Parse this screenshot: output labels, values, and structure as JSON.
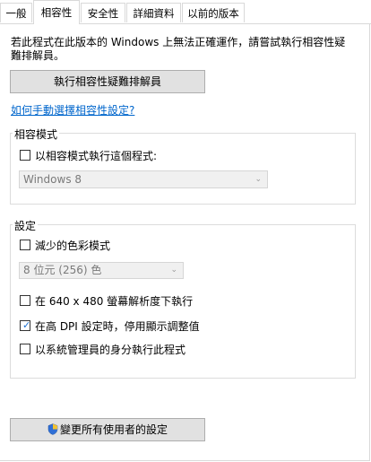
{
  "tabs": [
    {
      "label": "一般"
    },
    {
      "label": "相容性"
    },
    {
      "label": "安全性"
    },
    {
      "label": "詳細資料"
    },
    {
      "label": "以前的版本"
    }
  ],
  "intro": {
    "line1": "若此程式在此版本的 Windows 上無法正確運作，請嘗試執行相容性疑",
    "line2": "難排解員。"
  },
  "troubleshoot_button": "執行相容性疑難排解員",
  "manual_link": "如何手動選擇相容性設定?",
  "compat_mode": {
    "title": "相容模式",
    "checkbox_label": "以相容模式執行這個程式:",
    "checked": false,
    "selected_os": "Windows 8"
  },
  "settings": {
    "title": "設定",
    "reduced_color": {
      "label": "減少的色彩模式",
      "checked": false
    },
    "color_depth": "8 位元 (256) 色",
    "resolution_640": {
      "label": "在 640 x 480 螢幕解析度下執行",
      "checked": false
    },
    "high_dpi": {
      "label": "在高 DPI 設定時，停用顯示調整值",
      "checked": true
    },
    "run_as_admin": {
      "label": "以系統管理員的身分執行此程式",
      "checked": false
    }
  },
  "change_all_users_button": "變更所有使用者的設定",
  "colors": {
    "link": "#0066cc",
    "check": "#1a6fd1",
    "button_bg": "#e1e1e1"
  },
  "icons": {
    "admin": "uac-shield-icon",
    "dropdown": "chevron-down-icon",
    "check": "checkmark-icon"
  }
}
